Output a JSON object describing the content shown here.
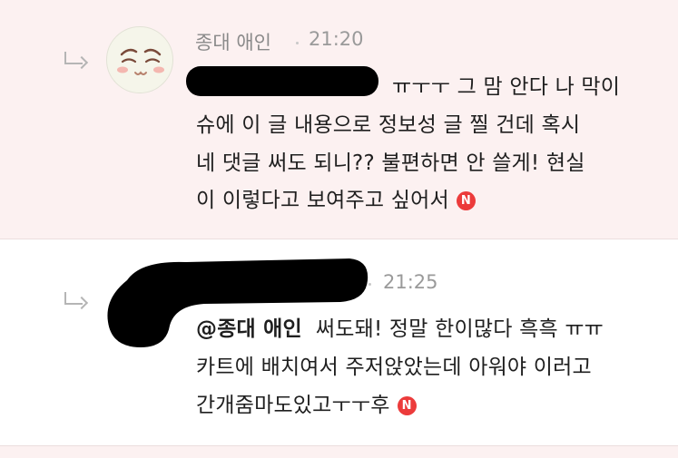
{
  "comments": [
    {
      "author": "종대 애인",
      "time": "21:20",
      "lines": [
        "ㅠㅜㅜ 그 맘 안다 나 막이",
        "슈에 이 글 내용으로 정보성 글 찔 건데 혹시",
        "네 댓글 써도 되니?? 불편하면 안 쓸게! 현실",
        "이 이렇다고 보여주고 싶어서"
      ],
      "badge": "N",
      "avatar_icon": "smiling-face-avatar-icon",
      "reply_icon": "reply-arrow-icon"
    },
    {
      "time": "21:25",
      "mention": "@종대 애인",
      "lines": [
        "써도돼! 정말 한이많다 흑흑 ㅠㅠ",
        "카트에 배치여서 주저앉았는데 아워야 이러고",
        "간개줌마도있고ㅜㅜ후"
      ],
      "badge": "N",
      "reply_icon": "reply-arrow-icon"
    }
  ],
  "colors": {
    "highlight_bg": "#fcf1f1",
    "badge": "#ec3b3b",
    "meta_text": "#8a8a8a"
  }
}
